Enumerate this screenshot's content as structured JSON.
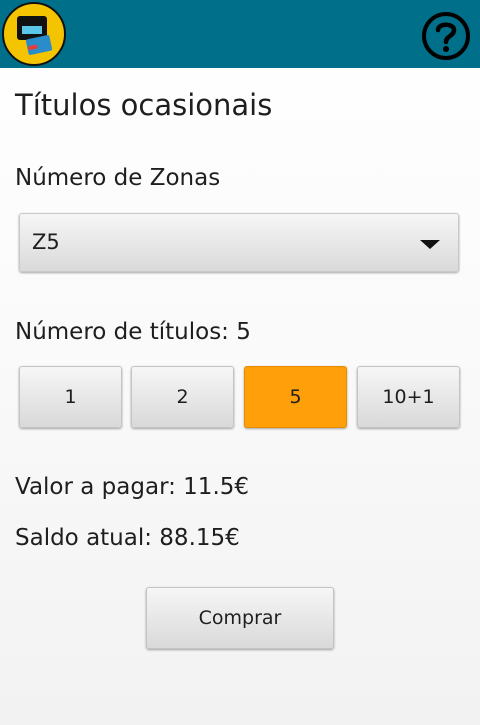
{
  "header": {
    "app_icon": "transit-card-app-icon",
    "help_icon": "help-circle-icon",
    "bar_color": "#006f8a"
  },
  "page": {
    "title": "Títulos ocasionais"
  },
  "zones": {
    "label": "Número de Zonas",
    "selected": "Z5",
    "dropdown_icon": "chevron-down-icon"
  },
  "tickets": {
    "label": "Número de títulos: 5",
    "options": [
      "1",
      "2",
      "5",
      "10+1"
    ],
    "selected_index": 2,
    "selected_color": "#ff9f0a"
  },
  "summary": {
    "amount_due": "Valor a pagar: 11.5€",
    "balance": "Saldo atual: 88.15€"
  },
  "actions": {
    "buy_label": "Comprar"
  }
}
